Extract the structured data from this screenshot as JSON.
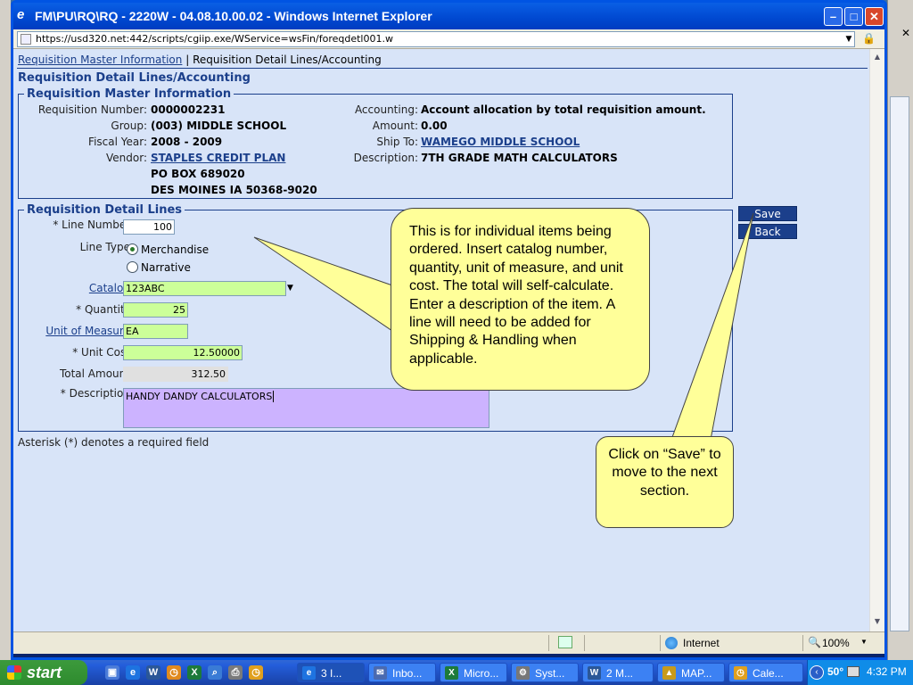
{
  "window": {
    "title": "FM\\PU\\RQ\\RQ - 2220W - 04.08.10.00.02 - Windows Internet Explorer",
    "url": "https://usd320.net:442/scripts/cgiip.exe/WService=wsFin/foreqdetl001.w"
  },
  "breadcrumb": {
    "link": "Requisition Master Information",
    "separator": "|",
    "current": "Requisition Detail Lines/Accounting"
  },
  "page_heading": "Requisition Detail Lines/Accounting",
  "master": {
    "legend": "Requisition Master Information",
    "req_number_label": "Requisition Number:",
    "req_number": "0000002231",
    "group_label": "Group:",
    "group": "(003) MIDDLE SCHOOL",
    "fiscal_year_label": "Fiscal Year:",
    "fiscal_year": "2008 - 2009",
    "vendor_label": "Vendor:",
    "vendor": "STAPLES CREDIT PLAN",
    "vendor_addr1": "PO BOX 689020",
    "vendor_addr2": "DES MOINES IA 50368-9020",
    "accounting_label": "Accounting:",
    "accounting": "Account allocation by total requisition amount.",
    "amount_label": "Amount:",
    "amount": "0.00",
    "ship_to_label": "Ship To:",
    "ship_to": "WAMEGO MIDDLE SCHOOL",
    "description_label": "Description:",
    "description": "7TH GRADE MATH CALCULATORS"
  },
  "detail": {
    "legend": "Requisition Detail Lines",
    "line_number_label": "* Line Number:",
    "line_number": "100",
    "line_type_label": "Line Type:",
    "line_type_options": [
      "Merchandise",
      "Narrative"
    ],
    "line_type_selected": "Merchandise",
    "catalog_label": "Catalog:",
    "catalog": "123ABC",
    "quantity_label": "* Quantity:",
    "quantity": "25",
    "uom_label": "Unit of Measure:",
    "uom": "EA",
    "unit_cost_label": "* Unit Cost:",
    "unit_cost": "12.50000",
    "total_label": "Total Amount:",
    "total": "312.50",
    "description_label": "* Description:",
    "description": "HANDY DANDY CALCULATORS"
  },
  "buttons": {
    "save": "Save",
    "back": "Back"
  },
  "footnote": "Asterisk (*) denotes a required field",
  "callouts": {
    "items": "This is for individual items being ordered.  Insert catalog number, quantity, unit of measure, and unit cost.  The total will self-calculate.  Enter a description of the item. A line will need to be added for Shipping & Handling when applicable.",
    "save": "Click on “Save” to move to the next section."
  },
  "status": {
    "zone": "Internet",
    "zoom": "100%"
  },
  "taskbar": {
    "start": "start",
    "buttons": [
      "3 I...",
      "Inbo...",
      "Micro...",
      "Syst...",
      "2 M...",
      "MAP...",
      "Cale..."
    ],
    "temperature": "50°",
    "clock": "4:32 PM"
  },
  "colors": {
    "page_bg": "#d8e4f8",
    "heading": "#1b3f8b",
    "input_green": "#ccff99",
    "input_purple": "#ccb3ff",
    "callout": "#ffff99",
    "button": "#1b3f8b"
  }
}
